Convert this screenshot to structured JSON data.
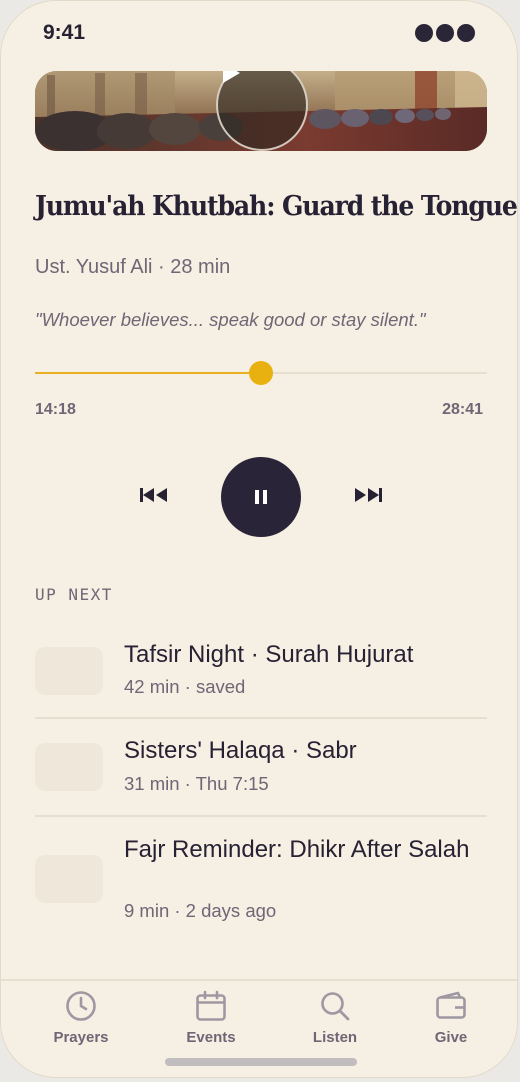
{
  "status_bar": {
    "time": "9:41",
    "signal_icon": "status-dots-icon"
  },
  "hero": {
    "play_icon": "play-icon"
  },
  "episode": {
    "title": "Jumu'ah Khutbah: Guard the Tongue",
    "meta": "Ust. Yusuf Ali · 28 min",
    "quote": "\"Whoever believes... speak good or stay silent.\""
  },
  "player": {
    "elapsed": "14:18",
    "total": "28:41",
    "progress": 0.5,
    "accent_color": "#e8b10f",
    "controls": {
      "previous_icon": "skip-previous-icon",
      "pause_icon": "pause-icon",
      "next_icon": "skip-next-icon"
    }
  },
  "up_next": {
    "heading": "UP NEXT",
    "items": [
      {
        "title": "Tafsir Night · Surah Hujurat",
        "subtitle": "42 min · saved"
      },
      {
        "title": "Sisters' Halaqa · Sabr",
        "subtitle": "31 min · Thu 7:15"
      },
      {
        "title": "Fajr Reminder: Dhikr After Salah",
        "subtitle": "9 min · 2 days ago"
      }
    ]
  },
  "tab_bar": {
    "tabs": [
      {
        "label": "Prayers",
        "icon": "clock-icon"
      },
      {
        "label": "Events",
        "icon": "calendar-icon"
      },
      {
        "label": "Listen",
        "icon": "search-icon"
      },
      {
        "label": "Give",
        "icon": "wallet-icon"
      }
    ]
  }
}
